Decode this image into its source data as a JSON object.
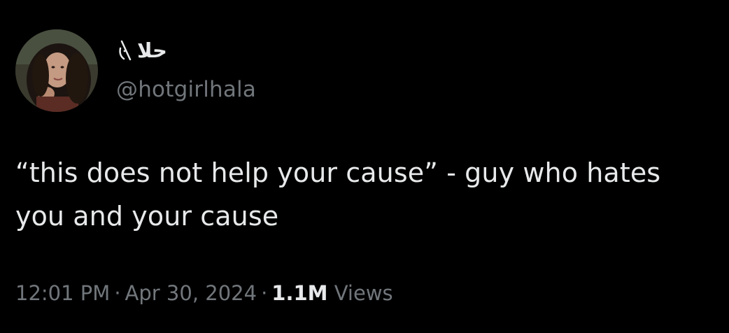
{
  "author": {
    "display_name": "حلا",
    "display_name_emoji": "watermelon-slice-icon",
    "handle": "@hotgirlhala"
  },
  "tweet": {
    "text": "“this does not help your cause” - guy who hates you and your cause"
  },
  "meta": {
    "time": "12:01 PM",
    "separator": "·",
    "date": "Apr 30, 2024",
    "views_count": "1.1M",
    "views_label": "Views"
  },
  "colors": {
    "background": "#000000",
    "primary_text": "#e7e9ea",
    "secondary_text": "#71767b"
  }
}
